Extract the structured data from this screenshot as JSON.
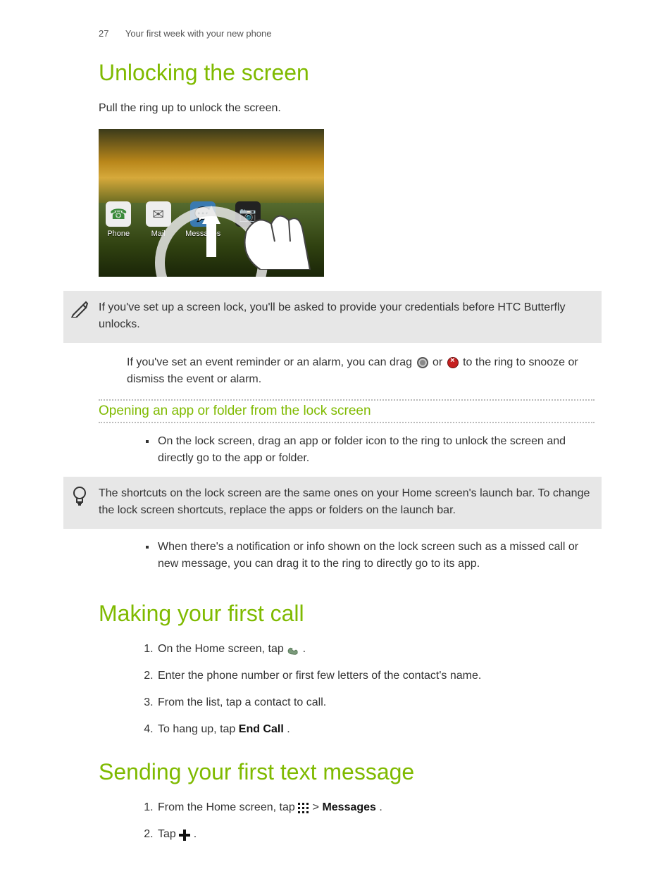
{
  "header": {
    "page_number": "27",
    "chapter": "Your first week with your new phone"
  },
  "section1": {
    "title": "Unlocking the screen",
    "intro": "Pull the ring up to unlock the screen.",
    "screenshot": {
      "dock": [
        {
          "label": "Phone"
        },
        {
          "label": "Mail"
        },
        {
          "label": "Messages"
        },
        {
          "label": ""
        }
      ]
    },
    "note1": "If you've set up a screen lock, you'll be asked to provide your credentials before HTC Butterfly unlocks.",
    "inline_para_a": "If you've set an event reminder or an alarm, you can drag ",
    "inline_para_b": " or ",
    "inline_para_c": " to the ring to snooze or dismiss the event or alarm.",
    "subsection_title": "Opening an app or folder from the lock screen",
    "bullet1": "On the lock screen, drag an app or folder icon to the ring to unlock the screen and directly go to the app or folder.",
    "note2": "The shortcuts on the lock screen are the same ones on your Home screen's launch bar. To change the lock screen shortcuts, replace the apps or folders on the launch bar.",
    "bullet2": "When there's a notification or info shown on the lock screen such as a missed call or new message, you can drag it to the ring to directly go to its app."
  },
  "section2": {
    "title": "Making your first call",
    "steps": {
      "s1a": "On the Home screen, tap ",
      "s1b": ".",
      "s2": "Enter the phone number or first few letters of the contact's name.",
      "s3": "From the list, tap a contact to call.",
      "s4a": "To hang up, tap ",
      "s4b": "End Call",
      "s4c": "."
    }
  },
  "section3": {
    "title": "Sending your first text message",
    "steps": {
      "s1a": "From the Home screen, tap ",
      "s1b": " > ",
      "s1c": "Messages",
      "s1d": ".",
      "s2a": "Tap ",
      "s2b": "."
    }
  }
}
